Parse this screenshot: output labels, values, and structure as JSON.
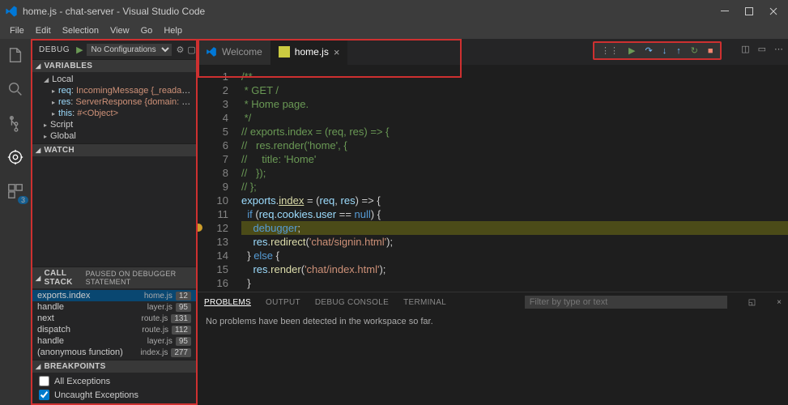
{
  "window": {
    "title": "home.js - chat-server - Visual Studio Code"
  },
  "menu": [
    "File",
    "Edit",
    "Selection",
    "View",
    "Go",
    "Help"
  ],
  "debug": {
    "label": "DEBUG",
    "config": "No Configurations",
    "toolbar": {
      "continue": "Continue",
      "step_over": "Step Over",
      "step_into": "Step Into",
      "step_out": "Step Out",
      "restart": "Restart",
      "stop": "Stop",
      "handle": "Drag"
    }
  },
  "tabs": [
    {
      "label": "Welcome",
      "active": false
    },
    {
      "label": "home.js",
      "active": true
    }
  ],
  "variables": {
    "title": "VARIABLES",
    "scopes": [
      {
        "name": "Local",
        "expanded": true,
        "items": [
          {
            "name": "req",
            "value": "IncomingMessage {_readableSta…"
          },
          {
            "name": "res",
            "value": "ServerResponse {domain: null,…"
          },
          {
            "name": "this",
            "value": "#<Object>"
          }
        ]
      },
      {
        "name": "Script",
        "expanded": false
      },
      {
        "name": "Global",
        "expanded": false
      }
    ]
  },
  "watch": {
    "title": "WATCH"
  },
  "callstack": {
    "title": "CALL STACK",
    "status": "PAUSED ON DEBUGGER STATEMENT",
    "frames": [
      {
        "fn": "exports.index",
        "file": "home.js",
        "line": "12",
        "sel": true
      },
      {
        "fn": "handle",
        "file": "layer.js",
        "line": "95"
      },
      {
        "fn": "next",
        "file": "route.js",
        "line": "131"
      },
      {
        "fn": "dispatch",
        "file": "route.js",
        "line": "112"
      },
      {
        "fn": "handle",
        "file": "layer.js",
        "line": "95"
      },
      {
        "fn": "(anonymous function)",
        "file": "index.js",
        "line": "277"
      }
    ]
  },
  "breakpoints": {
    "title": "BREAKPOINTS",
    "items": [
      {
        "label": "All Exceptions",
        "checked": false
      },
      {
        "label": "Uncaught Exceptions",
        "checked": true
      }
    ]
  },
  "code": {
    "lines": [
      "/**",
      " * GET /",
      " * Home page.",
      " */",
      "// exports.index = (req, res) => {",
      "//   res.render('home', {",
      "//     title: 'Home'",
      "//   });",
      "// };",
      "exports.index = (req, res) => {",
      "  if (req.cookies.user == null) {",
      "    debugger;",
      "    res.redirect('chat/signin.html');",
      "  } else {",
      "    res.render('chat/index.html');",
      "  }",
      "};"
    ],
    "breakpoint_line": 12
  },
  "panel": {
    "tabs": [
      "PROBLEMS",
      "OUTPUT",
      "DEBUG CONSOLE",
      "TERMINAL"
    ],
    "active": "PROBLEMS",
    "message": "No problems have been detected in the workspace so far.",
    "filter_placeholder": "Filter by type or text"
  },
  "activity_badge": "3"
}
